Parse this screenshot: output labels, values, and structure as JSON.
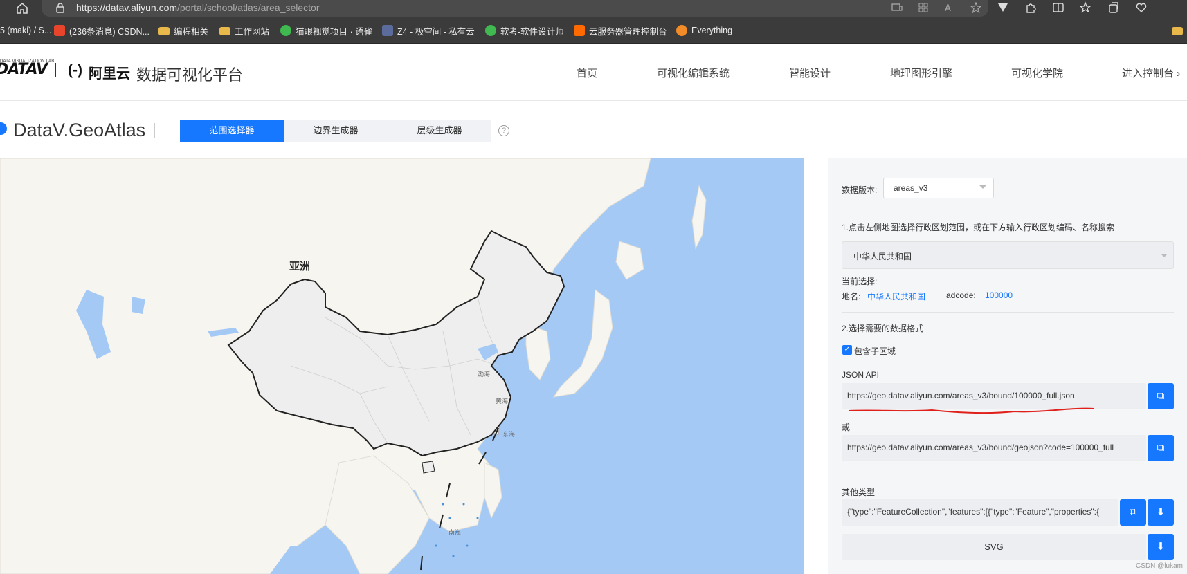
{
  "browser": {
    "url_host": "https://datav.aliyun.com",
    "url_path": "/portal/school/atlas/area_selector",
    "bookmarks": [
      "5 (maki) / S...",
      "(236条消息) CSDN...",
      "编程相关",
      "工作网站",
      "猫眼视觉项目 · 语雀",
      "Z4 - 极空间 - 私有云",
      "软考-软件设计师",
      "云服务器管理控制台",
      "Everything"
    ]
  },
  "header": {
    "logo_sub": "DATA VISUALIZATION LAB",
    "logo_main": "DATAV",
    "aliyun_mark": "(-)",
    "aliyun_text": "阿里云",
    "title": "数据可视化平台",
    "nav": [
      "首页",
      "可视化编辑系统",
      "智能设计",
      "地理图形引擎",
      "可视化学院",
      "进入控制台 ›"
    ]
  },
  "toolbar": {
    "geo_title": "DataV.GeoAtlas",
    "tabs": [
      "范围选择器",
      "边界生成器",
      "层级生成器"
    ],
    "help": "?"
  },
  "map": {
    "continent": "亚洲",
    "labels": [
      "渤海",
      "黄海",
      "东海",
      "南海"
    ],
    "colors": {
      "water": "#a5c9f5",
      "land": "#f7f5ef",
      "china": "#eeeeee",
      "border": "#222222"
    }
  },
  "panel": {
    "version_label": "数据版本:",
    "version_value": "areas_v3",
    "step1": "1.点击左侧地图选择行政区划范围，或在下方输入行政区划编码、名称搜索",
    "region_value": "中华人民共和国",
    "current_label": "当前选择:",
    "name_label": "地名:",
    "name_value": "中华人民共和国",
    "adcode_label": "adcode:",
    "adcode_value": "100000",
    "step2": "2.选择需要的数据格式",
    "include_sub": "包含子区域",
    "json_api_label": "JSON API",
    "json_api_url": "https://geo.datav.aliyun.com/areas_v3/bound/100000_full.json",
    "or_label": "或",
    "geojson_url": "https://geo.datav.aliyun.com/areas_v3/bound/geojson?code=100000_full",
    "other_label": "其他类型",
    "other_value": "{\"type\":\"FeatureCollection\",\"features\":[{\"type\":\"Feature\",\"properties\":{",
    "svg_label": "SVG"
  },
  "watermark": "CSDN @lukam"
}
